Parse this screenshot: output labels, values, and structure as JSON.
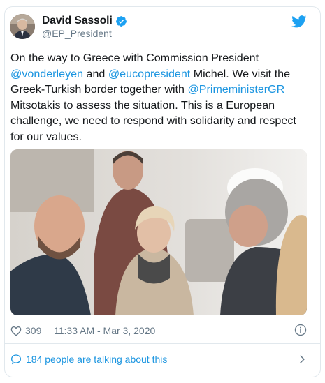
{
  "author": {
    "name": "David Sassoli",
    "handle": "@EP_President",
    "verified": true
  },
  "tweet": {
    "segments": [
      {
        "text": "On the way to Greece with Commission President ",
        "mention": false
      },
      {
        "text": "@vonderleyen",
        "mention": true
      },
      {
        "text": " and ",
        "mention": false
      },
      {
        "text": "@eucopresident",
        "mention": true
      },
      {
        "text": " Michel. We visit the Greek-Turkish border together with ",
        "mention": false
      },
      {
        "text": "@PrimeministerGR",
        "mention": true
      },
      {
        "text": " Mitsotakis to assess the situation. This is a European challenge, we need to respond with solidarity and respect for our values.",
        "mention": false
      }
    ]
  },
  "footer": {
    "like_count": "309",
    "timestamp": "11:33 AM - Mar 3, 2020",
    "conversation": "184 people are talking about this"
  },
  "icons": {
    "brand": "twitter-bird-icon",
    "verified": "verified-badge-icon",
    "like": "heart-icon",
    "info": "info-icon",
    "reply": "speech-bubble-icon",
    "chevron": "chevron-right-icon"
  },
  "colors": {
    "link": "#1b95e0",
    "text": "#14171a",
    "muted": "#657786",
    "border": "#e1e8ed"
  }
}
